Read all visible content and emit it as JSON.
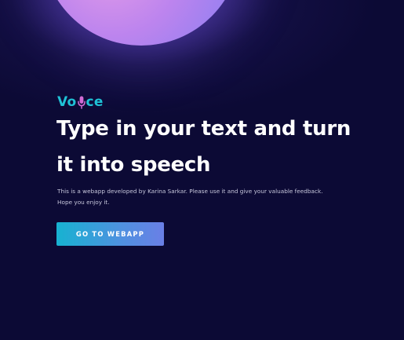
{
  "brand": {
    "prefix": "Vo",
    "mic_icon": "microphone-icon",
    "suffix": "ce",
    "color": "#1fc2d6"
  },
  "hero": {
    "headline_line1": "Type in your text and turn",
    "headline_line2": "it into speech",
    "description_line1": "This is a webapp developed by Karina Sarkar. Please use it and give your valuable feedback.",
    "description_line2": "Hope you enjoy it.",
    "cta_label": "GO TO WEBAPP"
  },
  "colors": {
    "background": "#0c0a35",
    "orb_pink": "#e39be8",
    "orb_blue": "#7d86ef",
    "button_start": "#17b2d1",
    "button_end": "#6a7fe6"
  }
}
